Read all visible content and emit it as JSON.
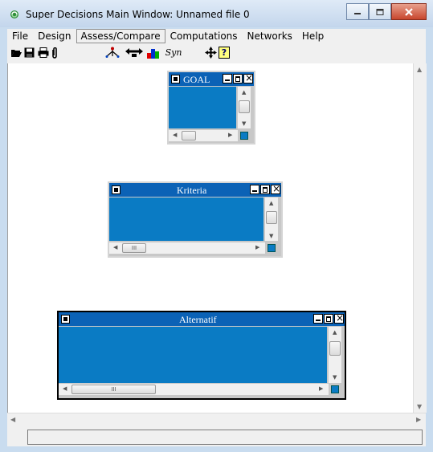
{
  "window": {
    "title": "Super Decisions Main Window: Unnamed file 0"
  },
  "menu": [
    {
      "label": "File"
    },
    {
      "label": "Design"
    },
    {
      "label": "Assess/Compare",
      "active": true
    },
    {
      "label": "Computations"
    },
    {
      "label": "Networks"
    },
    {
      "label": "Help"
    }
  ],
  "toolbar": {
    "left_icons": [
      "open-folder-icon",
      "save-icon",
      "print-icon",
      "attach-icon"
    ],
    "right_icons": [
      "node-tree-icon",
      "compare-icon",
      "bar-chart-icon",
      "synthesis-icon",
      "move-icon",
      "help-icon"
    ],
    "syn_label": "Syn",
    "help_glyph": "?"
  },
  "nodes": {
    "goal": {
      "name": "GOAL"
    },
    "criteria": {
      "name": "Kriteria"
    },
    "alternatives": {
      "name": "Alternatif"
    }
  },
  "scroll_glyphs": {
    "grip": "III"
  },
  "colors": {
    "node_title": "#0b62b6",
    "node_body": "#0a7bc4",
    "window_frame": "#c9dcef"
  }
}
